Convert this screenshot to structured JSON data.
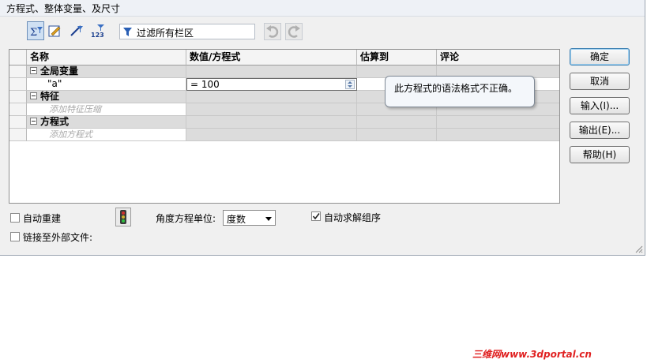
{
  "window": {
    "title": "方程式、整体变量、及尺寸"
  },
  "toolbar": {
    "buttons": [
      {
        "icon": "equation-view-icon",
        "selected": true
      },
      {
        "icon": "sketch-equation-icon",
        "selected": false
      },
      {
        "icon": "dimension-view-icon",
        "selected": false
      },
      {
        "icon": "ordered-view-123-icon",
        "selected": false
      }
    ],
    "filter_placeholder": "过滤所有栏区",
    "undo_icon": "undo-icon",
    "redo_icon": "redo-icon"
  },
  "grid": {
    "columns": [
      "名称",
      "数值/方程式",
      "估算到",
      "评论"
    ],
    "groups": {
      "global": "全局变量",
      "feature": "特征",
      "equation": "方程式"
    },
    "rows": {
      "variable_name": "\"a\"",
      "variable_value": "= 100",
      "feature_placeholder": "添加特征压缩",
      "equation_placeholder": "添加方程式"
    }
  },
  "tooltip": {
    "text": "此方程式的语法格式不正确。"
  },
  "buttons": {
    "ok": "确定",
    "cancel": "取消",
    "import": "输入(I)...",
    "export": "输出(E)...",
    "help": "帮助(H)"
  },
  "options": {
    "auto_rebuild": "自动重建",
    "link_external": "链接至外部文件:",
    "angle_unit_label": "角度方程单位:",
    "angle_unit_value": "度数",
    "auto_solve": "自动求解组序",
    "auto_rebuild_checked": false,
    "link_external_checked": false,
    "auto_solve_checked": true
  },
  "watermark": "三维网www.3dportal.cn"
}
